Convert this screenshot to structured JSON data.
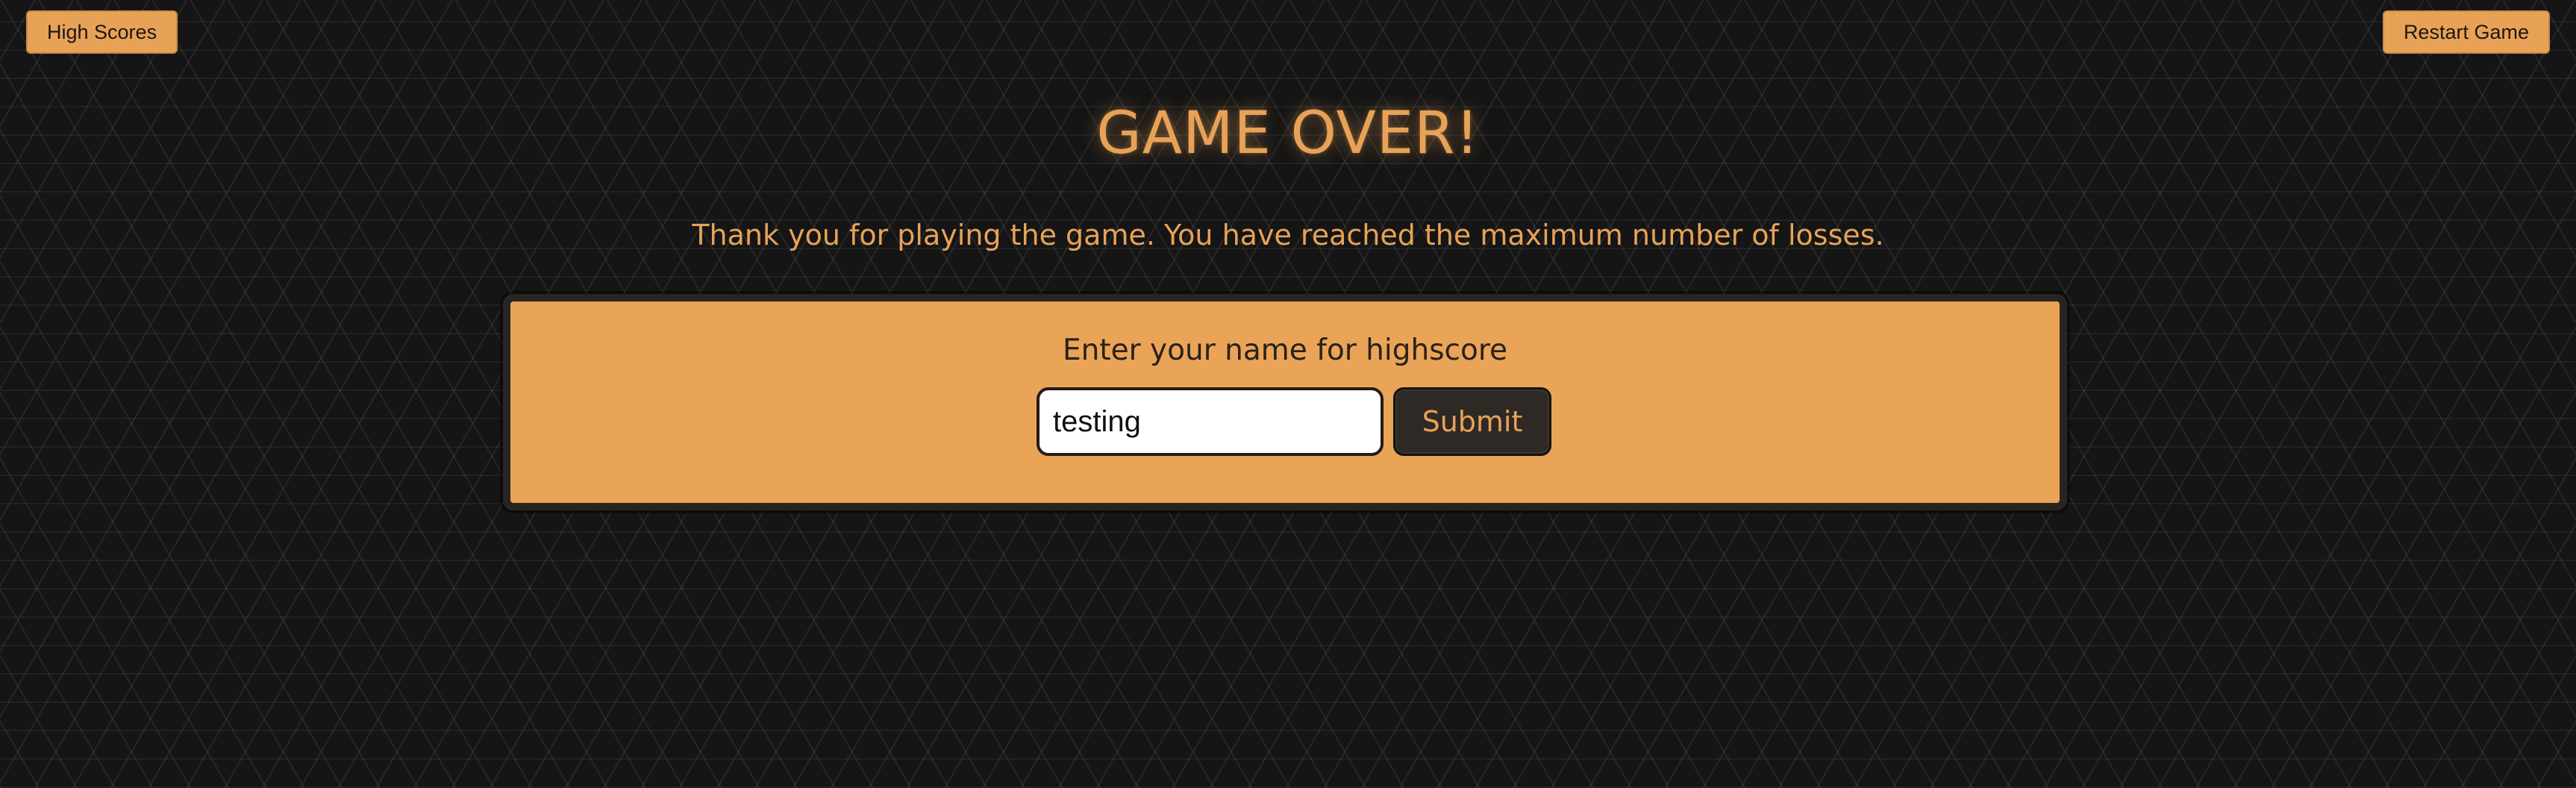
{
  "header": {
    "high_scores_label": "High Scores",
    "restart_label": "Restart Game"
  },
  "game_over": {
    "title": "GAME OVER!",
    "message": "Thank you for playing the game. You have reached the maximum number of losses."
  },
  "highscore_form": {
    "prompt": "Enter your name for highscore",
    "name_value": "testing",
    "submit_label": "Submit"
  },
  "colors": {
    "accent": "#e8a257",
    "background": "#151515",
    "panel_border": "#272421",
    "button_dark": "#2e2925"
  }
}
